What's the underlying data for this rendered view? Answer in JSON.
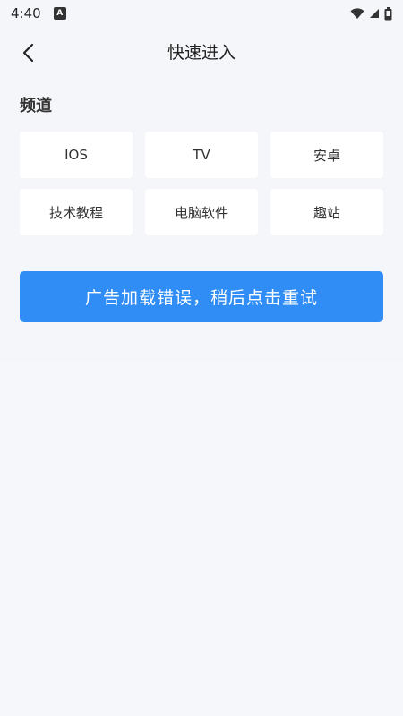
{
  "status_bar": {
    "time": "4:40",
    "notification_icon": "a-badge-icon",
    "wifi_icon": "wifi-icon",
    "signal_icon": "signal-icon",
    "battery_icon": "battery-icon"
  },
  "header": {
    "back_icon": "chevron-left-icon",
    "title": "快速进入"
  },
  "channels": {
    "title": "频道",
    "items": [
      {
        "label": "IOS"
      },
      {
        "label": "TV"
      },
      {
        "label": "安卓"
      },
      {
        "label": "技术教程"
      },
      {
        "label": "电脑软件"
      },
      {
        "label": "趣站"
      }
    ]
  },
  "ad": {
    "label": "广告加载错误，稍后点击重试",
    "color": "#2f8df5"
  }
}
